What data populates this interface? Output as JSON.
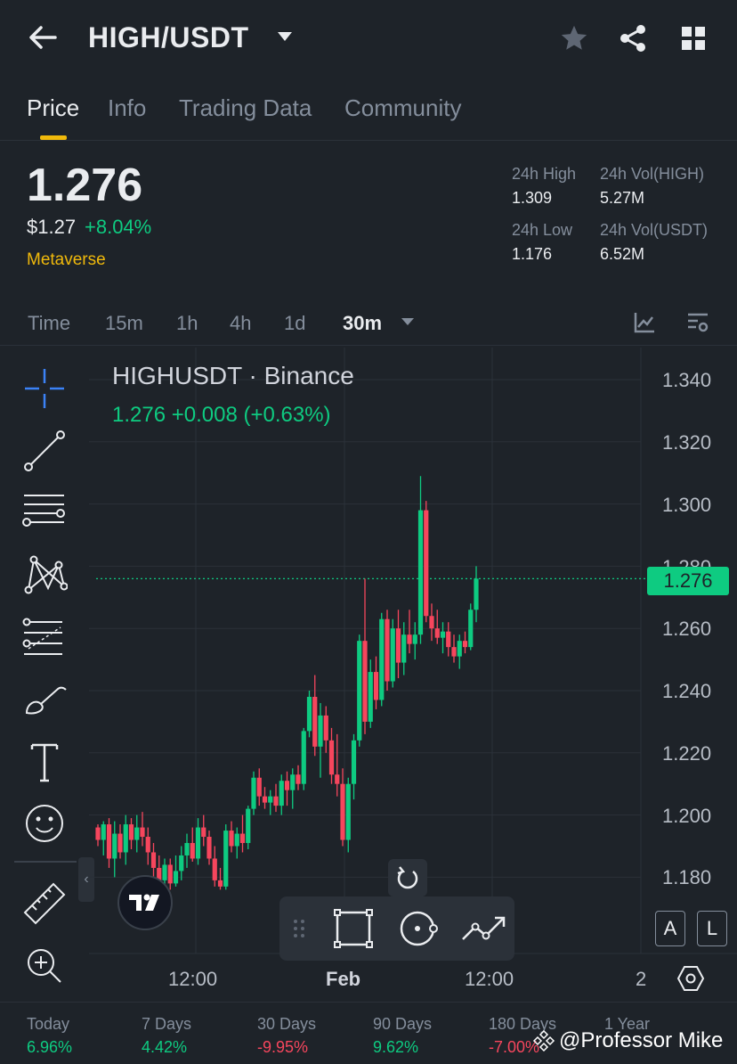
{
  "header": {
    "pair": "HIGH/USDT",
    "icons": [
      "back-arrow-icon",
      "chevron-down-icon",
      "star-icon",
      "share-icon",
      "grid-icon"
    ]
  },
  "tabs": [
    "Price",
    "Info",
    "Trading Data",
    "Community"
  ],
  "ticker": {
    "price": "1.276",
    "usd_price": "$1.27",
    "change_pct": "+8.04%",
    "tag": "Metaverse",
    "high_label": "24h High",
    "high_value": "1.309",
    "low_label": "24h Low",
    "low_value": "1.176",
    "vol_base_label": "24h Vol(HIGH)",
    "vol_base_value": "5.27M",
    "vol_quote_label": "24h Vol(USDT)",
    "vol_quote_value": "6.52M"
  },
  "intervals": {
    "items": [
      "Time",
      "15m",
      "1h",
      "4h",
      "1d"
    ],
    "selected": "30m"
  },
  "chart": {
    "title": "HIGHUSDT · Binance",
    "quote": "1.276  +0.008 (+0.63%)",
    "last_price": "1.276",
    "y_ticks": [
      "1.340",
      "1.320",
      "1.300",
      "1.280",
      "1.260",
      "1.240",
      "1.220",
      "1.200",
      "1.180"
    ],
    "x_ticks": [
      "12:00",
      "Feb",
      "12:00",
      "2"
    ],
    "buttons": {
      "auto": "A",
      "log": "L"
    },
    "up_color": "#0ecb81",
    "down_color": "#f6465d"
  },
  "chart_data": {
    "type": "candlestick",
    "title": "HIGHUSDT · Binance",
    "ylim": [
      1.168,
      1.348
    ],
    "y_ticks": [
      1.34,
      1.32,
      1.3,
      1.28,
      1.26,
      1.24,
      1.22,
      1.2,
      1.18
    ],
    "x_ticks": [
      "12:00",
      "Feb",
      "12:00",
      "2"
    ],
    "last_price": 1.276,
    "candles": [
      {
        "o": 1.196,
        "h": 1.197,
        "l": 1.19,
        "c": 1.192
      },
      {
        "o": 1.192,
        "h": 1.198,
        "l": 1.187,
        "c": 1.197
      },
      {
        "o": 1.197,
        "h": 1.199,
        "l": 1.183,
        "c": 1.186
      },
      {
        "o": 1.186,
        "h": 1.198,
        "l": 1.18,
        "c": 1.194
      },
      {
        "o": 1.194,
        "h": 1.197,
        "l": 1.186,
        "c": 1.188
      },
      {
        "o": 1.188,
        "h": 1.2,
        "l": 1.184,
        "c": 1.197
      },
      {
        "o": 1.197,
        "h": 1.199,
        "l": 1.189,
        "c": 1.192
      },
      {
        "o": 1.192,
        "h": 1.2,
        "l": 1.188,
        "c": 1.196
      },
      {
        "o": 1.196,
        "h": 1.201,
        "l": 1.19,
        "c": 1.193
      },
      {
        "o": 1.193,
        "h": 1.196,
        "l": 1.184,
        "c": 1.188
      },
      {
        "o": 1.188,
        "h": 1.191,
        "l": 1.18,
        "c": 1.183
      },
      {
        "o": 1.183,
        "h": 1.187,
        "l": 1.176,
        "c": 1.179
      },
      {
        "o": 1.179,
        "h": 1.186,
        "l": 1.176,
        "c": 1.184
      },
      {
        "o": 1.184,
        "h": 1.186,
        "l": 1.176,
        "c": 1.178
      },
      {
        "o": 1.178,
        "h": 1.187,
        "l": 1.177,
        "c": 1.182
      },
      {
        "o": 1.182,
        "h": 1.19,
        "l": 1.179,
        "c": 1.187
      },
      {
        "o": 1.187,
        "h": 1.194,
        "l": 1.183,
        "c": 1.191
      },
      {
        "o": 1.191,
        "h": 1.196,
        "l": 1.185,
        "c": 1.186
      },
      {
        "o": 1.186,
        "h": 1.199,
        "l": 1.184,
        "c": 1.196
      },
      {
        "o": 1.196,
        "h": 1.2,
        "l": 1.19,
        "c": 1.193
      },
      {
        "o": 1.193,
        "h": 1.195,
        "l": 1.184,
        "c": 1.186
      },
      {
        "o": 1.186,
        "h": 1.19,
        "l": 1.177,
        "c": 1.179
      },
      {
        "o": 1.179,
        "h": 1.183,
        "l": 1.176,
        "c": 1.177
      },
      {
        "o": 1.177,
        "h": 1.197,
        "l": 1.176,
        "c": 1.195
      },
      {
        "o": 1.195,
        "h": 1.198,
        "l": 1.188,
        "c": 1.19
      },
      {
        "o": 1.19,
        "h": 1.196,
        "l": 1.186,
        "c": 1.194
      },
      {
        "o": 1.194,
        "h": 1.2,
        "l": 1.188,
        "c": 1.191
      },
      {
        "o": 1.191,
        "h": 1.203,
        "l": 1.189,
        "c": 1.202
      },
      {
        "o": 1.202,
        "h": 1.214,
        "l": 1.2,
        "c": 1.212
      },
      {
        "o": 1.212,
        "h": 1.215,
        "l": 1.203,
        "c": 1.206
      },
      {
        "o": 1.206,
        "h": 1.209,
        "l": 1.202,
        "c": 1.204
      },
      {
        "o": 1.204,
        "h": 1.208,
        "l": 1.2,
        "c": 1.206
      },
      {
        "o": 1.206,
        "h": 1.21,
        "l": 1.201,
        "c": 1.203
      },
      {
        "o": 1.203,
        "h": 1.213,
        "l": 1.2,
        "c": 1.211
      },
      {
        "o": 1.211,
        "h": 1.214,
        "l": 1.203,
        "c": 1.208
      },
      {
        "o": 1.208,
        "h": 1.215,
        "l": 1.202,
        "c": 1.213
      },
      {
        "o": 1.213,
        "h": 1.216,
        "l": 1.208,
        "c": 1.21
      },
      {
        "o": 1.21,
        "h": 1.228,
        "l": 1.208,
        "c": 1.227
      },
      {
        "o": 1.227,
        "h": 1.24,
        "l": 1.225,
        "c": 1.238
      },
      {
        "o": 1.238,
        "h": 1.245,
        "l": 1.219,
        "c": 1.222
      },
      {
        "o": 1.222,
        "h": 1.236,
        "l": 1.212,
        "c": 1.232
      },
      {
        "o": 1.232,
        "h": 1.235,
        "l": 1.22,
        "c": 1.224
      },
      {
        "o": 1.224,
        "h": 1.228,
        "l": 1.21,
        "c": 1.213
      },
      {
        "o": 1.213,
        "h": 1.226,
        "l": 1.206,
        "c": 1.21
      },
      {
        "o": 1.21,
        "h": 1.215,
        "l": 1.19,
        "c": 1.192
      },
      {
        "o": 1.192,
        "h": 1.212,
        "l": 1.188,
        "c": 1.21
      },
      {
        "o": 1.21,
        "h": 1.226,
        "l": 1.205,
        "c": 1.224
      },
      {
        "o": 1.224,
        "h": 1.258,
        "l": 1.222,
        "c": 1.256
      },
      {
        "o": 1.256,
        "h": 1.276,
        "l": 1.226,
        "c": 1.23
      },
      {
        "o": 1.23,
        "h": 1.25,
        "l": 1.228,
        "c": 1.246
      },
      {
        "o": 1.246,
        "h": 1.251,
        "l": 1.234,
        "c": 1.237
      },
      {
        "o": 1.237,
        "h": 1.265,
        "l": 1.235,
        "c": 1.263
      },
      {
        "o": 1.263,
        "h": 1.266,
        "l": 1.24,
        "c": 1.243
      },
      {
        "o": 1.243,
        "h": 1.263,
        "l": 1.241,
        "c": 1.26
      },
      {
        "o": 1.26,
        "h": 1.266,
        "l": 1.244,
        "c": 1.249
      },
      {
        "o": 1.249,
        "h": 1.262,
        "l": 1.245,
        "c": 1.258
      },
      {
        "o": 1.258,
        "h": 1.266,
        "l": 1.252,
        "c": 1.255
      },
      {
        "o": 1.255,
        "h": 1.262,
        "l": 1.25,
        "c": 1.258
      },
      {
        "o": 1.258,
        "h": 1.309,
        "l": 1.255,
        "c": 1.298
      },
      {
        "o": 1.298,
        "h": 1.301,
        "l": 1.262,
        "c": 1.264
      },
      {
        "o": 1.264,
        "h": 1.268,
        "l": 1.256,
        "c": 1.26
      },
      {
        "o": 1.26,
        "h": 1.266,
        "l": 1.255,
        "c": 1.257
      },
      {
        "o": 1.257,
        "h": 1.262,
        "l": 1.252,
        "c": 1.259
      },
      {
        "o": 1.259,
        "h": 1.262,
        "l": 1.251,
        "c": 1.254
      },
      {
        "o": 1.254,
        "h": 1.258,
        "l": 1.249,
        "c": 1.251
      },
      {
        "o": 1.251,
        "h": 1.258,
        "l": 1.247,
        "c": 1.256
      },
      {
        "o": 1.256,
        "h": 1.259,
        "l": 1.252,
        "c": 1.254
      },
      {
        "o": 1.254,
        "h": 1.268,
        "l": 1.253,
        "c": 1.266
      },
      {
        "o": 1.266,
        "h": 1.28,
        "l": 1.262,
        "c": 1.276
      }
    ]
  },
  "performance": [
    {
      "label": "Today",
      "value": "6.96%",
      "color": "#0ecb81"
    },
    {
      "label": "7 Days",
      "value": "4.42%",
      "color": "#0ecb81"
    },
    {
      "label": "30 Days",
      "value": "-9.95%",
      "color": "#f6465d"
    },
    {
      "label": "90 Days",
      "value": "9.62%",
      "color": "#0ecb81"
    },
    {
      "label": "180 Days",
      "value": "-7.00%",
      "color": "#f6465d"
    },
    {
      "label": "1 Year",
      "value": "",
      "color": "#f6465d"
    }
  ],
  "watermark": "@Professor Mike"
}
